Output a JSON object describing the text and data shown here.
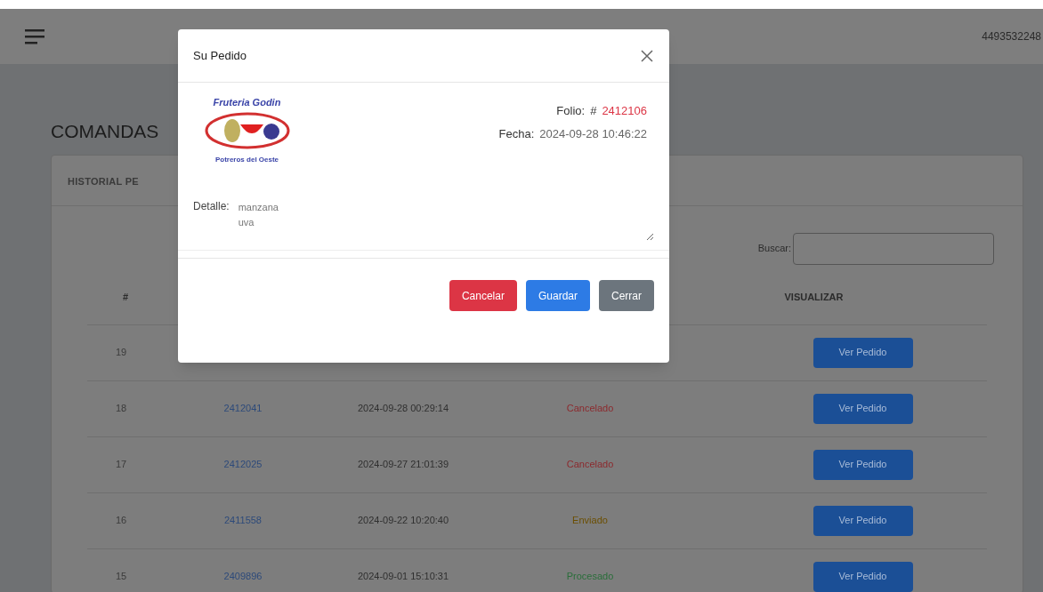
{
  "header": {
    "phone": "4493532248"
  },
  "page": {
    "title": "COMANDAS",
    "card_title": "HISTORIAL PE",
    "search_label": "Buscar:"
  },
  "table": {
    "columns": [
      "#",
      "VISUALIZAR"
    ],
    "rows": [
      {
        "number": "19",
        "button": "Ver Pedido"
      },
      {
        "number": "18",
        "folio": "2412041",
        "date": "2024-09-28 00:29:14",
        "status": "Cancelado",
        "color": "#8c2a2e",
        "button": "Ver Pedido"
      },
      {
        "number": "17",
        "folio": "2412025",
        "date": "2024-09-27 21:01:39",
        "status": "Cancelado",
        "color": "#8c2a2e",
        "button": "Ver Pedido"
      },
      {
        "number": "16",
        "folio": "2411558",
        "date": "2024-09-22 10:20:40",
        "status": "Enviado",
        "color": "#6b4e00",
        "button": "Ver Pedido"
      },
      {
        "number": "15",
        "folio": "2409896",
        "date": "2024-09-01 15:10:31",
        "status": "Procesado",
        "color": "#2a6e3a",
        "button": "Ver Pedido"
      }
    ]
  },
  "modal": {
    "title": "Su Pedido",
    "logo_top": "Fruteria Godin",
    "logo_bottom": "Potreros del Oeste",
    "folio_label": "Folio:",
    "folio_hash": "#",
    "folio": "2412106",
    "fecha_label": "Fecha:",
    "fecha": "2024-09-28 10:46:22",
    "detalle_label": "Detalle:",
    "detalle": "manzana\nuva",
    "buttons": [
      {
        "label": "Cancelar",
        "kind": "danger"
      },
      {
        "label": "Guardar",
        "kind": "primary"
      },
      {
        "label": "Cerrar",
        "kind": "secondary"
      }
    ]
  }
}
